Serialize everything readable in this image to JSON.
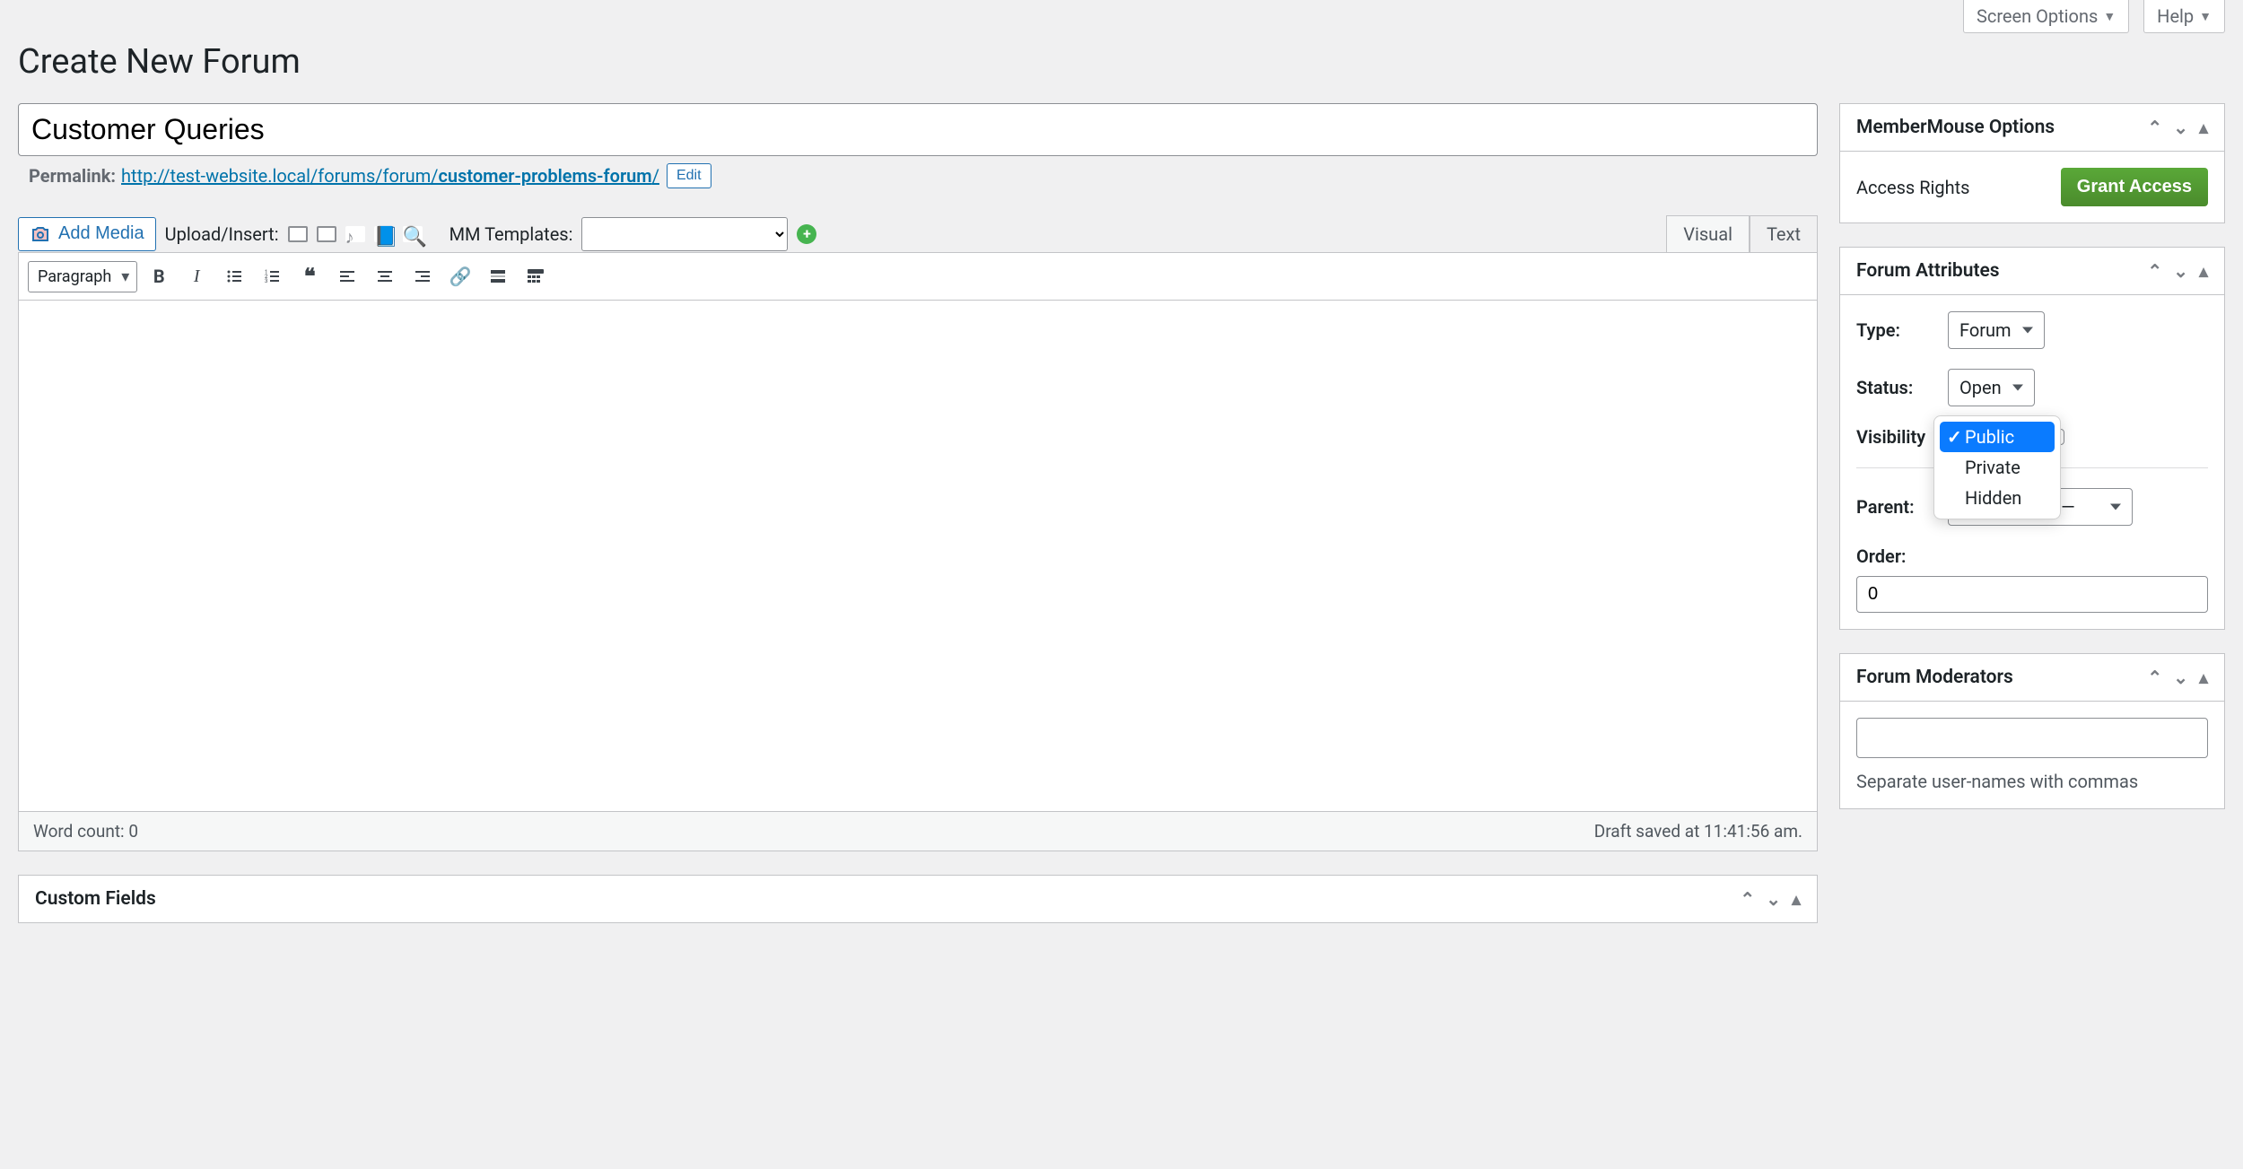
{
  "top": {
    "screen_options": "Screen Options",
    "help": "Help"
  },
  "page_title": "Create New Forum",
  "title_value": "Customer Queries",
  "permalink": {
    "label": "Permalink:",
    "url_prefix": "http://test-website.local/forums/forum/",
    "slug": "customer-problems-forum",
    "trail": "/",
    "edit": "Edit"
  },
  "media": {
    "add_media": "Add Media",
    "upload_insert": "Upload/Insert:",
    "mm_templates": "MM Templates:"
  },
  "editor_tabs": {
    "visual": "Visual",
    "text": "Text"
  },
  "toolbar": {
    "format": "Paragraph"
  },
  "status_bar": {
    "word_count_label": "Word count:",
    "word_count_value": "0",
    "draft_saved": "Draft saved at 11:41:56 am."
  },
  "custom_fields": {
    "title": "Custom Fields"
  },
  "side": {
    "mm_options": {
      "title": "MemberMouse Options",
      "access_label": "Access Rights",
      "grant": "Grant Access"
    },
    "forum_attributes": {
      "title": "Forum Attributes",
      "type_label": "Type:",
      "type_value": "Forum",
      "status_label": "Status:",
      "status_value": "Open",
      "visibility_label": "Visibility",
      "visibility_options": {
        "public": "Public",
        "private": "Private",
        "hidden": "Hidden"
      },
      "parent_label": "Parent:",
      "parent_value": "— No parent —",
      "order_label": "Order:",
      "order_value": "0"
    },
    "moderators": {
      "title": "Forum Moderators",
      "help": "Separate user-names with commas"
    }
  }
}
